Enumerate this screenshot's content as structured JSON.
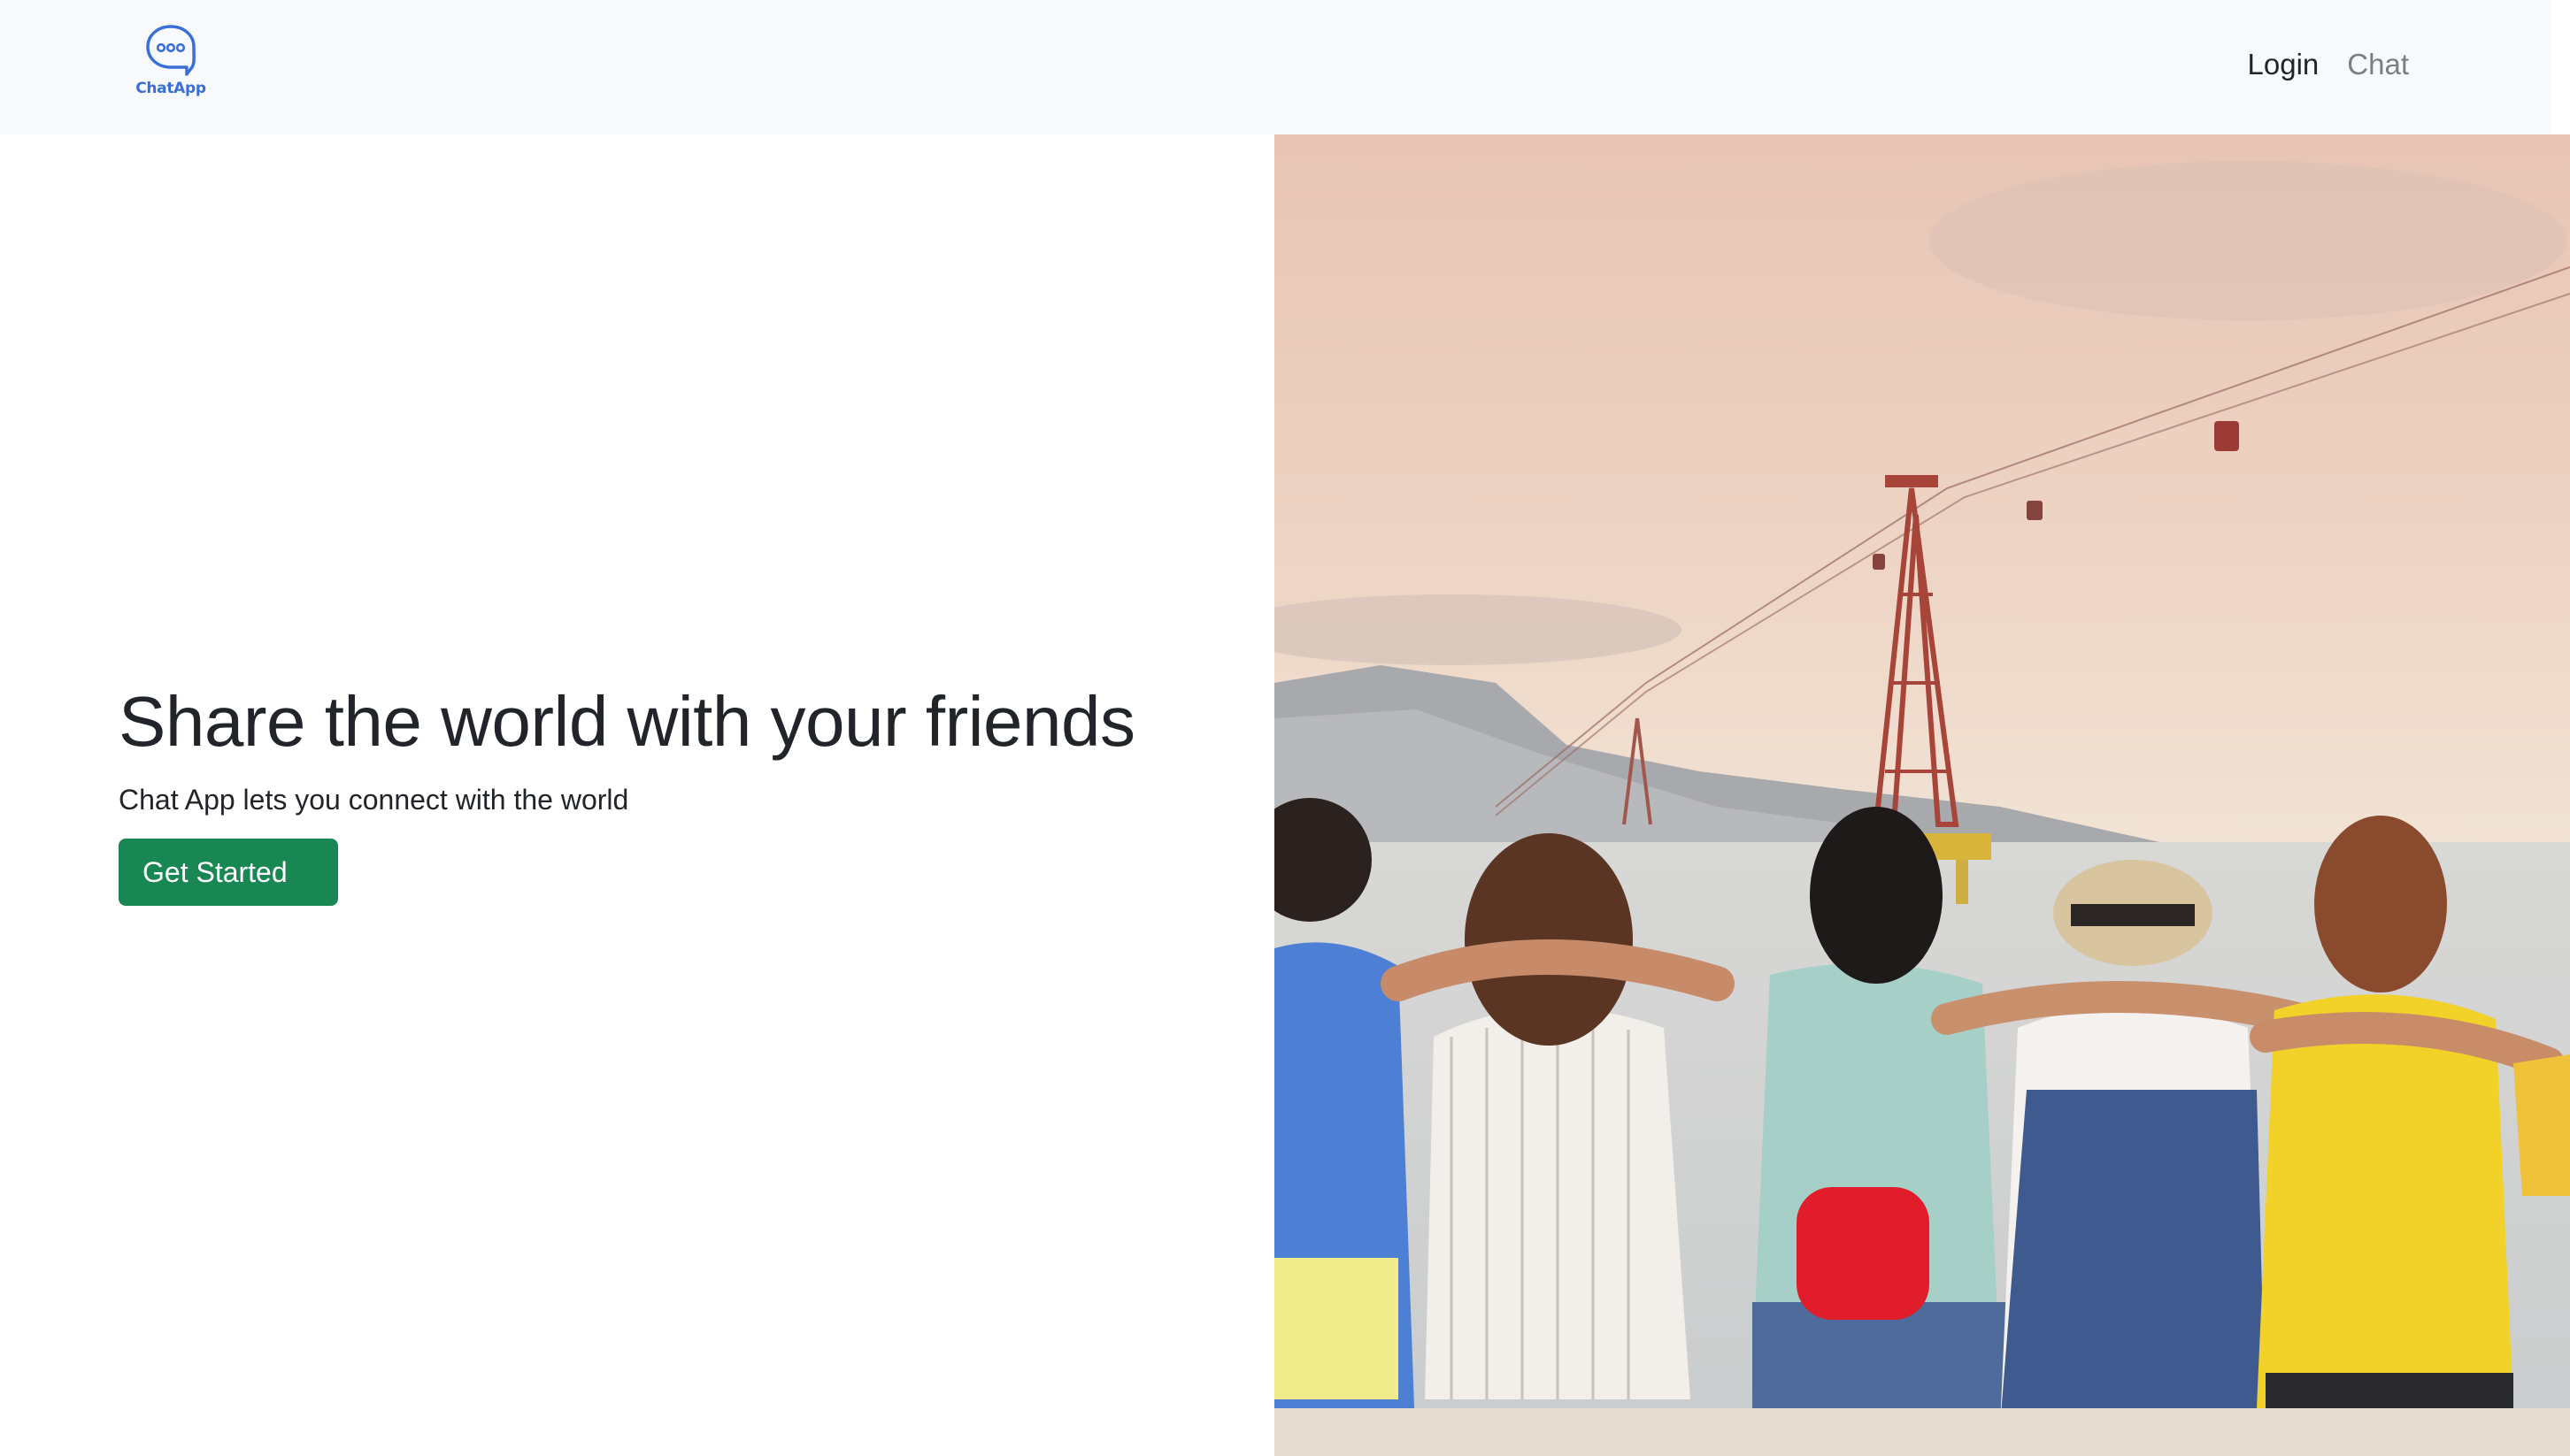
{
  "navbar": {
    "logo_text": "ChatApp",
    "links": [
      {
        "label": "Login",
        "state": "active"
      },
      {
        "label": "Chat",
        "state": "muted"
      }
    ]
  },
  "hero": {
    "title": "Share the world with your friends",
    "subtitle": "Chat App lets you connect with the world",
    "cta_label": "Get Started"
  },
  "colors": {
    "navbar_bg": "#f8f9fa",
    "logo_accent": "#3a6fd8",
    "cta_bg": "#198754",
    "text": "#212529",
    "muted_link": "#7b7f84"
  },
  "icons": {
    "logo": "chat-bubble-icon"
  }
}
